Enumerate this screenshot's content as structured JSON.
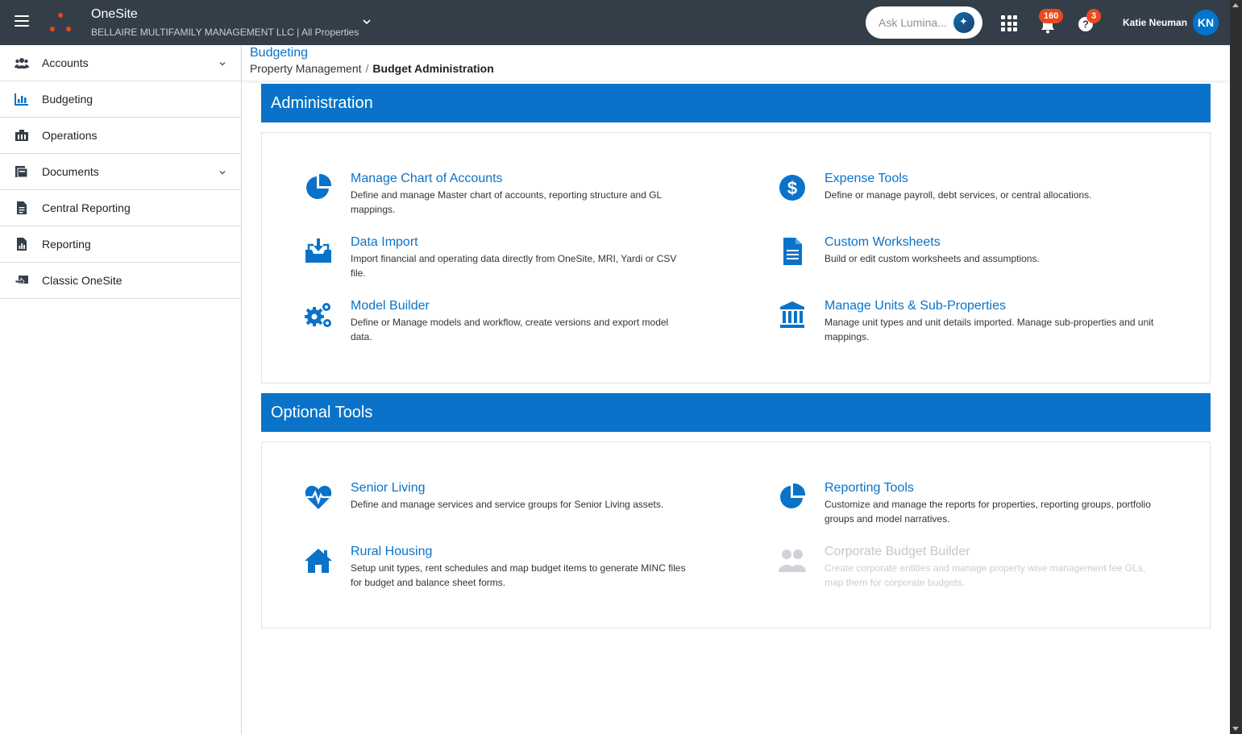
{
  "topbar": {
    "app_title": "OneSite",
    "company": "BELLAIRE MULTIFAMILY MANAGEMENT LLC | All Properties",
    "ask_placeholder": "Ask Lumina...",
    "notification_count": "160",
    "help_count": "3",
    "user_name": "Katie Neuman",
    "user_initials": "KN"
  },
  "sidebar": {
    "items": [
      {
        "label": "Accounts",
        "icon": "users-icon",
        "has_chevron": true
      },
      {
        "label": "Budgeting",
        "icon": "bar-chart-icon",
        "has_chevron": false
      },
      {
        "label": "Operations",
        "icon": "building-icon",
        "has_chevron": false
      },
      {
        "label": "Documents",
        "icon": "folder-icon",
        "has_chevron": true
      },
      {
        "label": "Central Reporting",
        "icon": "document-icon",
        "has_chevron": false
      },
      {
        "label": "Reporting",
        "icon": "report-icon",
        "has_chevron": false
      },
      {
        "label": "Classic OneSite",
        "icon": "classic-icon",
        "has_chevron": false
      }
    ]
  },
  "header": {
    "module_title": "Budgeting",
    "breadcrumb_parent": "Property Management",
    "breadcrumb_separator": "/",
    "breadcrumb_current": "Budget Administration"
  },
  "administration": {
    "title": "Administration",
    "tools": [
      {
        "title": "Manage Chart of Accounts",
        "desc": "Define and manage Master chart of accounts, reporting structure and GL mappings.",
        "icon": "pie-chart-icon"
      },
      {
        "title": "Expense Tools",
        "desc": "Define or manage payroll, debt services, or central allocations.",
        "icon": "dollar-icon"
      },
      {
        "title": "Data Import",
        "desc": "Import financial and operating data directly from OneSite, MRI, Yardi or CSV file.",
        "icon": "inbox-download-icon"
      },
      {
        "title": "Custom Worksheets",
        "desc": "Build or edit custom worksheets and assumptions.",
        "icon": "worksheet-icon"
      },
      {
        "title": "Model Builder",
        "desc": "Define or Manage models and workflow, create versions and export model data.",
        "icon": "gears-icon"
      },
      {
        "title": "Manage Units & Sub-Properties",
        "desc": "Manage unit types and unit details imported. Manage sub-properties and unit mappings.",
        "icon": "bank-icon"
      }
    ]
  },
  "optional_tools": {
    "title": "Optional Tools",
    "tools": [
      {
        "title": "Senior Living",
        "desc": "Define and manage services and service groups for Senior Living assets.",
        "icon": "heartbeat-icon"
      },
      {
        "title": "Reporting Tools",
        "desc": "Customize and manage the reports for properties, reporting groups, portfolio groups and model narratives.",
        "icon": "pie-chart-icon"
      },
      {
        "title": "Rural Housing",
        "desc": "Setup unit types, rent schedules and map budget items to generate MINC files for budget and balance sheet forms.",
        "icon": "home-icon"
      },
      {
        "title": "Corporate Budget Builder",
        "desc": "Create corporate entities and manage property wise management fee GLs, map them for corporate budgets.",
        "icon": "users-icon",
        "disabled": true
      }
    ]
  },
  "colors": {
    "topbar": "#343e48",
    "accent": "#0a73c9",
    "badge": "#e8491d",
    "avatar": "#0075cf"
  }
}
